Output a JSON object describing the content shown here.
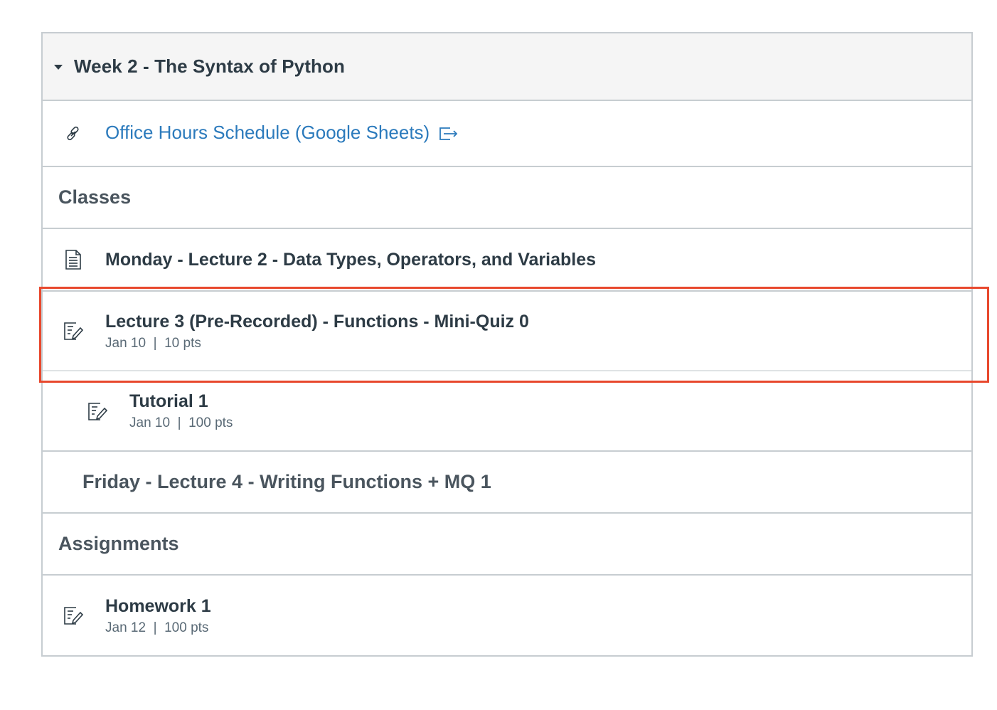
{
  "module": {
    "title": "Week 2 - The Syntax of Python"
  },
  "items": {
    "office_hours": {
      "label": "Office Hours Schedule (Google Sheets)",
      "icon": "link-icon",
      "external_icon": "external-link-icon"
    },
    "classes_header": {
      "label": "Classes"
    },
    "monday": {
      "label": "Monday - Lecture 2 - Data Types, Operators, and Variables",
      "icon": "page-icon"
    },
    "lecture3": {
      "label": "Lecture 3 (Pre-Recorded) - Functions - Mini-Quiz 0",
      "date": "Jan 10",
      "sep": "|",
      "points": "10 pts",
      "icon": "quiz-icon"
    },
    "tutorial1": {
      "label": "Tutorial 1",
      "date": "Jan 10",
      "sep": "|",
      "points": "100 pts",
      "icon": "quiz-icon"
    },
    "friday": {
      "label": "Friday - Lecture 4 - Writing Functions + MQ 1"
    },
    "assignments_header": {
      "label": "Assignments"
    },
    "homework1": {
      "label": "Homework 1",
      "date": "Jan 12",
      "sep": "|",
      "points": "100 pts",
      "icon": "assignment-icon"
    }
  },
  "colors": {
    "link": "#2b7abc",
    "highlight": "#e8482d",
    "border": "#c7cdd1",
    "header_bg": "#f5f5f5"
  }
}
